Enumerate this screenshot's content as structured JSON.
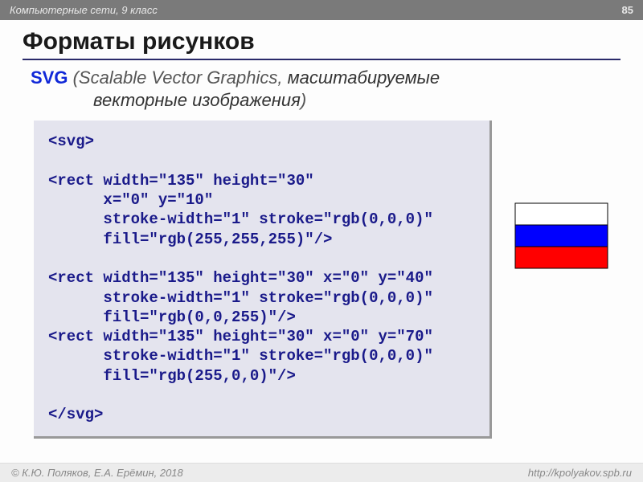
{
  "header": {
    "course": "Компьютерные сети, 9 класс",
    "page": "85"
  },
  "title": "Форматы рисунков",
  "subtitle": {
    "label": "SVG",
    "paren_open": "(",
    "english": "Scalable Vector Graphics,",
    "russian": "масштабируемые",
    "russian2": "векторные изображения",
    "paren_close": ")"
  },
  "code": "<svg>\n\n<rect width=\"135\" height=\"30\"\n      x=\"0\" y=\"10\"\n      stroke-width=\"1\" stroke=\"rgb(0,0,0)\"\n      fill=\"rgb(255,255,255)\"/>\n\n<rect width=\"135\" height=\"30\" x=\"0\" y=\"40\"\n      stroke-width=\"1\" stroke=\"rgb(0,0,0)\"\n      fill=\"rgb(0,0,255)\"/>\n<rect width=\"135\" height=\"30\" x=\"0\" y=\"70\"\n      stroke-width=\"1\" stroke=\"rgb(0,0,0)\"\n      fill=\"rgb(255,0,0)\"/>\n\n</svg>",
  "flag": {
    "rect_w": 115,
    "rect_h": 27,
    "stripes": [
      {
        "fill": "#ffffff"
      },
      {
        "fill": "#0000ff"
      },
      {
        "fill": "#ff0000"
      }
    ]
  },
  "footer": {
    "author": "К.Ю. Поляков, Е.А. Ерёмин, 2018",
    "url": "http://kpolyakov.spb.ru"
  }
}
